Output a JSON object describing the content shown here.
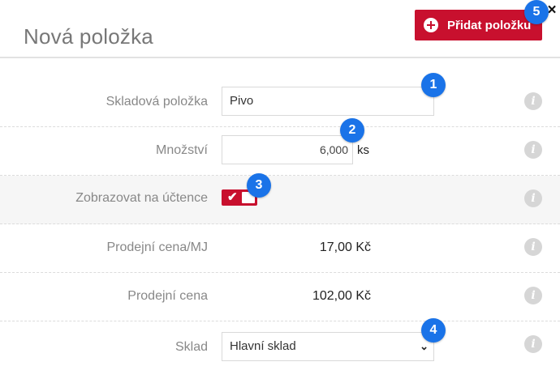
{
  "header": {
    "title": "Nová položka",
    "add_button_label": "Přidat položku",
    "close_glyph": "×"
  },
  "form": {
    "rows": [
      {
        "label": "Skladová položka",
        "value": "Pivo"
      },
      {
        "label": "Množství",
        "value": "6,000",
        "unit": "ks"
      },
      {
        "label": "Zobrazovat na účtence",
        "checked": true,
        "check_glyph": "✔"
      },
      {
        "label": "Prodejní cena/MJ",
        "value": "17,00 Kč"
      },
      {
        "label": "Prodejní cena",
        "value": "102,00 Kč"
      },
      {
        "label": "Sklad",
        "value": "Hlavní sklad",
        "chevron": "⌄"
      }
    ],
    "info_glyph": "i"
  },
  "badges": [
    "1",
    "2",
    "3",
    "4",
    "5"
  ],
  "colors": {
    "accent": "#c8102e",
    "badge": "#1a73e8",
    "info_icon": "#d6d6d6",
    "shaded_row": "#f6f6f6"
  }
}
